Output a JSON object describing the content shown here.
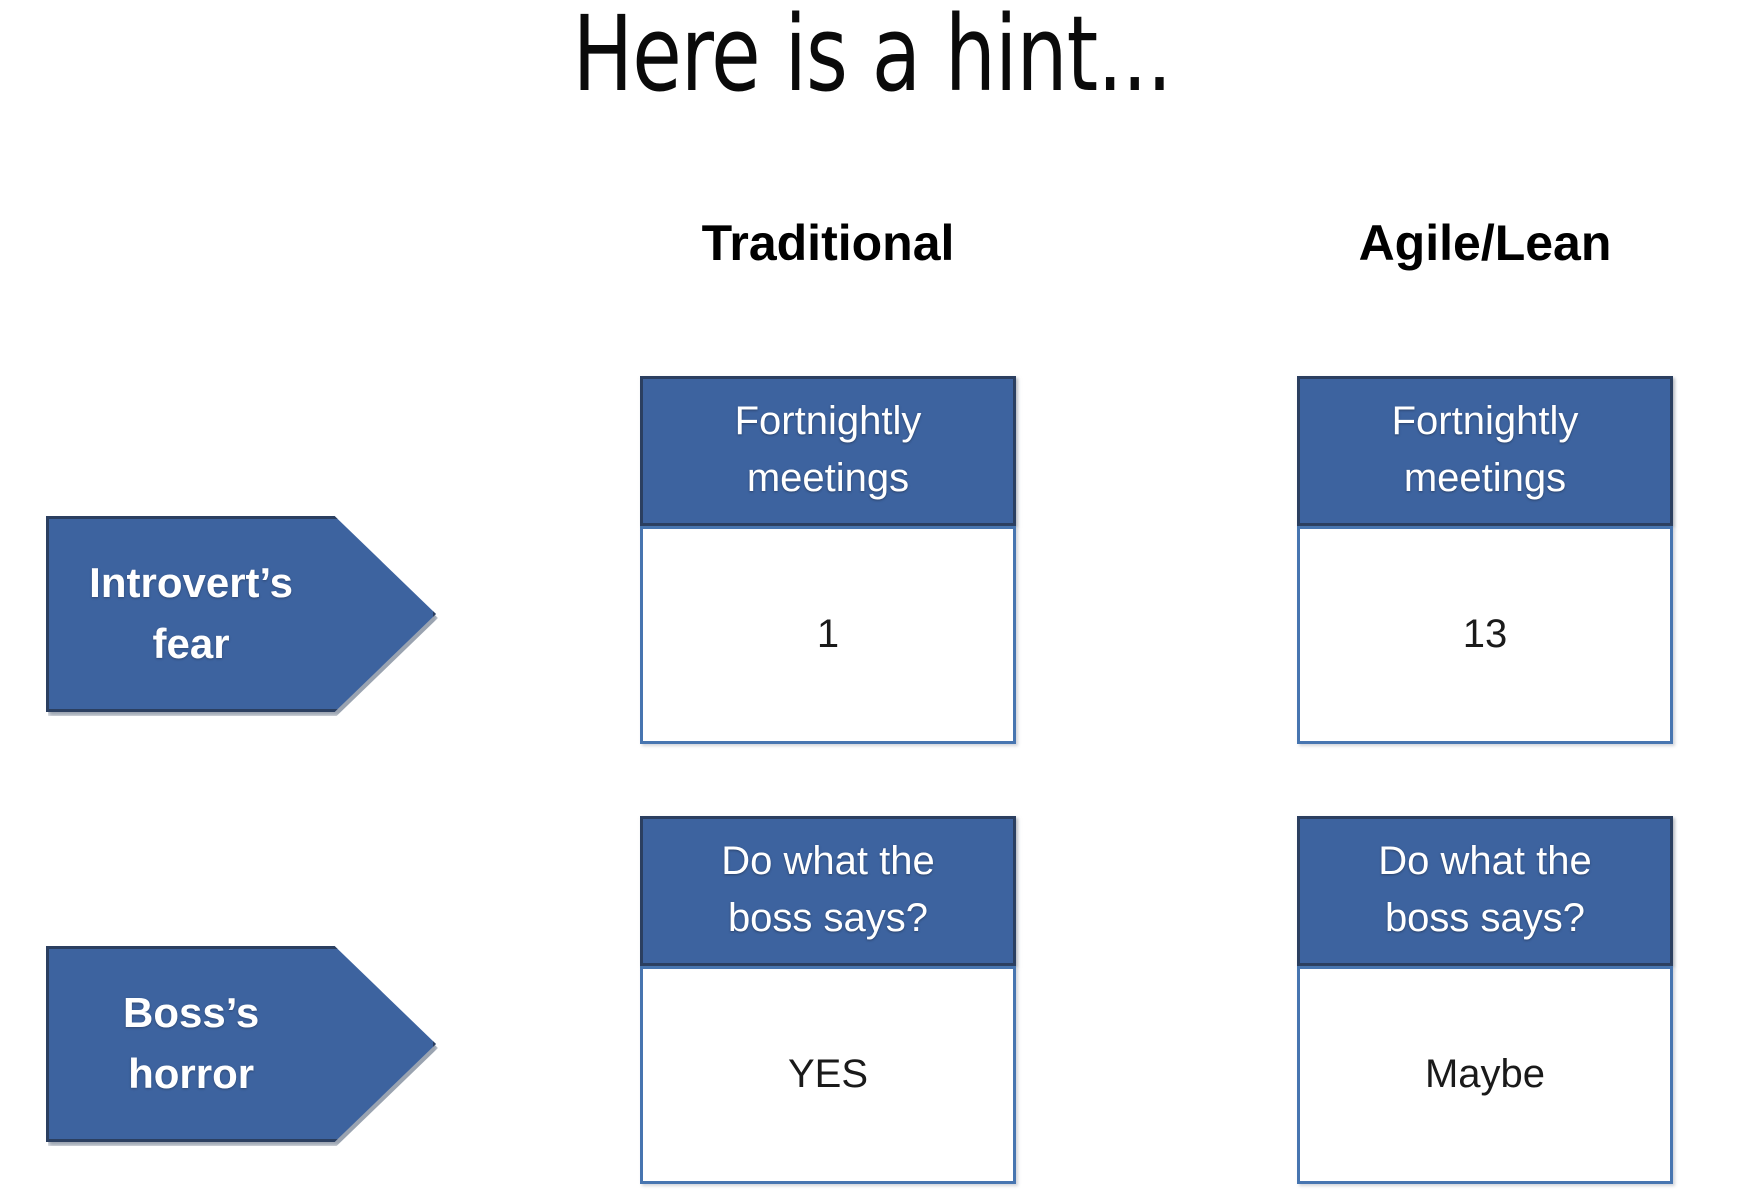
{
  "slide": {
    "title": "Here is a hint...",
    "background_color": "#FFFFFF"
  },
  "theme": {
    "accent_blue": "#3D639F",
    "accent_blue_border": "#2B3F60",
    "body_border_blue": "#4775B0",
    "text_on_accent": "#FFFFFF",
    "text_dark": "#000000"
  },
  "columns": [
    {
      "id": "traditional",
      "label": "Traditional"
    },
    {
      "id": "agile_lean",
      "label": "Agile/Lean"
    }
  ],
  "rows": [
    {
      "id": "introverts-fear",
      "arrow_label_line1": "Introvert’s",
      "arrow_label_line2": "fear",
      "question_line1": "Fortnightly",
      "question_line2": "meetings",
      "traditional_value": "1",
      "agile_value": "13"
    },
    {
      "id": "bosss-horror",
      "arrow_label_line1": "Boss’s",
      "arrow_label_line2": "horror",
      "question_line1": "Do what the",
      "question_line2": "boss says?",
      "traditional_value": "YES",
      "agile_value": "Maybe"
    }
  ],
  "chart_data": {
    "type": "table",
    "title": "Here is a hint...",
    "row_labels": [
      "Introvert’s fear",
      "Boss’s horror"
    ],
    "row_questions": [
      "Fortnightly meetings",
      "Do what the boss says?"
    ],
    "categories": [
      "Traditional",
      "Agile/Lean"
    ],
    "series": [
      {
        "name": "Fortnightly meetings",
        "values": [
          "1",
          "13"
        ]
      },
      {
        "name": "Do what the boss says?",
        "values": [
          "YES",
          "Maybe"
        ]
      }
    ]
  }
}
